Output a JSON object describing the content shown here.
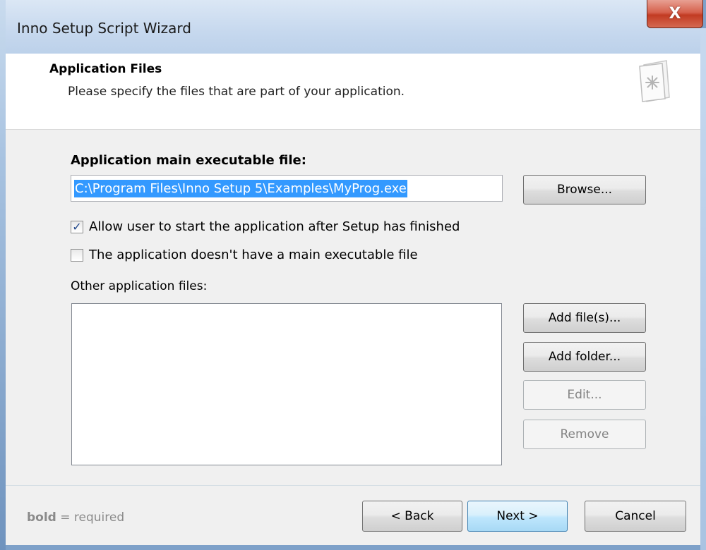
{
  "window": {
    "title": "Inno Setup Script Wizard",
    "close_glyph": "X"
  },
  "header": {
    "title": "Application Files",
    "subtitle": "Please specify the files that are part of your application.",
    "icon": "setup-document-icon"
  },
  "main_exe": {
    "label": "Application main executable file:",
    "value": "C:\\Program Files\\Inno Setup 5\\Examples\\MyProg.exe",
    "browse_label": "Browse..."
  },
  "options": [
    {
      "label": "Allow user to start the application after Setup has finished",
      "checked": true
    },
    {
      "label": "The application doesn't have a main executable file",
      "checked": false
    }
  ],
  "other_files": {
    "label": "Other application files:",
    "items": [],
    "add_files_label": "Add file(s)...",
    "add_folder_label": "Add folder...",
    "edit_label": "Edit...",
    "remove_label": "Remove"
  },
  "footer": {
    "hint_bold": "bold",
    "hint_rest": " = required",
    "back_label": "< Back",
    "next_label": "Next >",
    "cancel_label": "Cancel"
  },
  "colors": {
    "selection": "#3399ff",
    "close_button": "#c23b22",
    "default_button": "#bee6fd"
  }
}
